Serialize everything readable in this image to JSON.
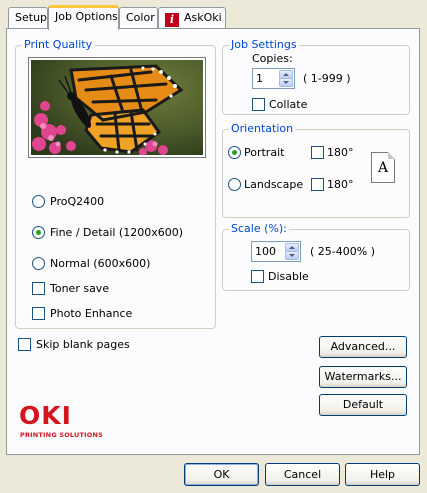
{
  "tabs": [
    {
      "label": "Setup",
      "active": false
    },
    {
      "label": "Job Options",
      "active": true
    },
    {
      "label": "Color",
      "active": false
    },
    {
      "label": "AskOki",
      "active": false,
      "icon": "info-icon"
    }
  ],
  "print_quality": {
    "title": "Print Quality",
    "preview_image": "monarch-butterfly-on-pink-flowers",
    "options": [
      {
        "label": "ProQ2400",
        "selected": false
      },
      {
        "label": "Fine / Detail (1200x600)",
        "selected": true
      },
      {
        "label": "Normal (600x600)",
        "selected": false
      }
    ],
    "toner_save": {
      "label": "Toner save",
      "checked": false
    },
    "photo_enhance": {
      "label": "Photo Enhance",
      "checked": false
    }
  },
  "skip_blank": {
    "label": "Skip blank pages",
    "checked": false
  },
  "job_settings": {
    "title": "Job Settings",
    "copies_label": "Copies:",
    "copies_value": "1",
    "copies_range": "( 1-999 )",
    "collate": {
      "label": "Collate",
      "checked": false
    }
  },
  "orientation": {
    "title": "Orientation",
    "portrait": {
      "label": "Portrait",
      "selected": true
    },
    "landscape": {
      "label": "Landscape",
      "selected": false
    },
    "rotate_portrait": {
      "label": "180°",
      "checked": false
    },
    "rotate_landscape": {
      "label": "180°",
      "checked": false
    },
    "page_icon_letter": "A"
  },
  "scale": {
    "title": "Scale (%):",
    "value": "100",
    "range": "( 25-400% )",
    "disable": {
      "label": "Disable",
      "checked": false
    }
  },
  "side_buttons": {
    "advanced": "Advanced...",
    "watermarks": "Watermarks...",
    "default": "Default"
  },
  "logo": {
    "brand": "OKI",
    "tagline": "PRINTING SOLUTIONS",
    "color": "#d4141f"
  },
  "dialog_buttons": {
    "ok": "OK",
    "cancel": "Cancel",
    "help": "Help"
  },
  "colors": {
    "group_title": "#0046d5",
    "active_tab_accent": "#ffc83c",
    "radio_dot": "#21a121"
  }
}
